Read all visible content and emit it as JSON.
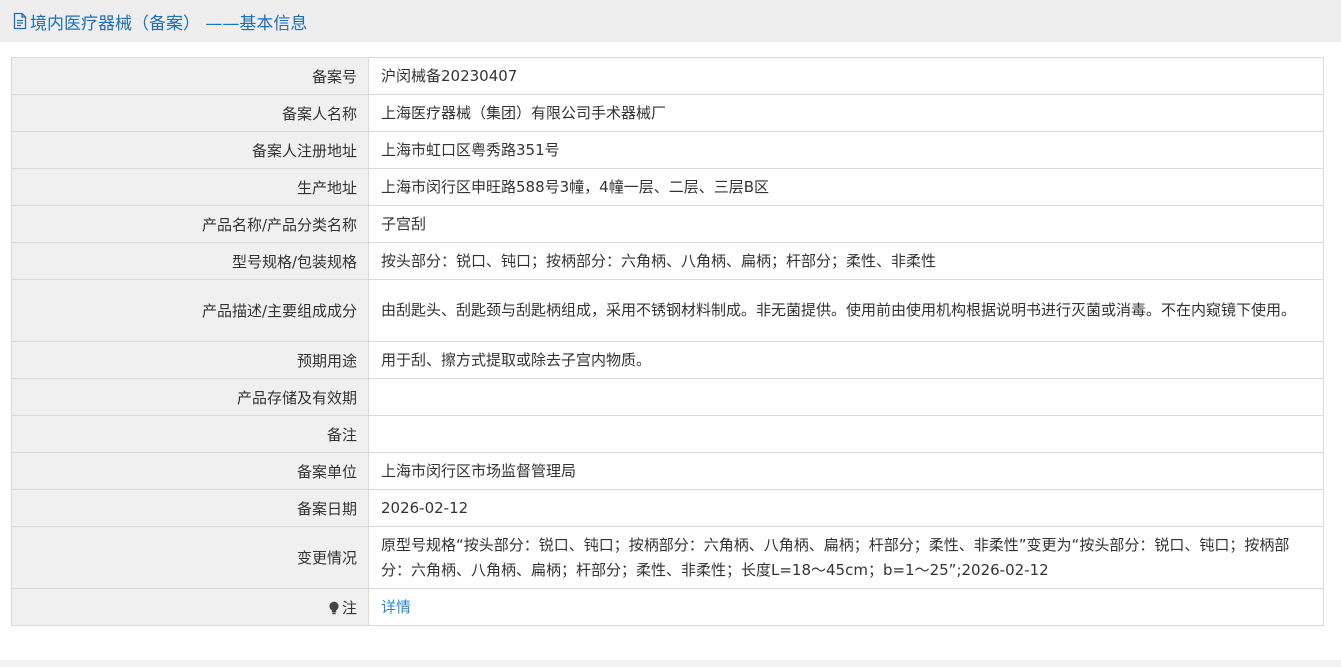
{
  "header": {
    "icon": "document-icon",
    "title": "境内医疗器械（备案） ——基本信息"
  },
  "rows": [
    {
      "label": "备案号",
      "value": "沪闵械备20230407"
    },
    {
      "label": "备案人名称",
      "value": "上海医疗器械（集团）有限公司手术器械厂"
    },
    {
      "label": "备案人注册地址",
      "value": "上海市虹口区粤秀路351号"
    },
    {
      "label": "生产地址",
      "value": "上海市闵行区申旺路588号3幢，4幢一层、二层、三层B区"
    },
    {
      "label": "产品名称/产品分类名称",
      "value": "子宫刮"
    },
    {
      "label": "型号规格/包装规格",
      "value": "按头部分：锐口、钝口；按柄部分：六角柄、八角柄、扁柄；杆部分；柔性、非柔性"
    },
    {
      "label": "产品描述/主要组成成分",
      "value": "由刮匙头、刮匙颈与刮匙柄组成，采用不锈钢材料制成。非无菌提供。使用前由使用机构根据说明书进行灭菌或消毒。不在内窥镜下使用。"
    },
    {
      "label": "预期用途",
      "value": "用于刮、擦方式提取或除去子宫内物质。"
    },
    {
      "label": "产品存储及有效期",
      "value": ""
    },
    {
      "label": "备注",
      "value": ""
    },
    {
      "label": "备案单位",
      "value": "上海市闵行区市场监督管理局"
    },
    {
      "label": "备案日期",
      "value": "2026-02-12"
    },
    {
      "label": "变更情况",
      "value": "原型号规格“按头部分：锐口、钝口；按柄部分：六角柄、八角柄、扁柄；杆部分；柔性、非柔性”变更为“按头部分：锐口、钝口；按柄部分：六角柄、八角柄、扁柄；杆部分；柔性、非柔性；长度L=18～45cm；b=1～25”;2026-02-12"
    }
  ],
  "note": {
    "icon": "lightbulb-icon",
    "label": "注",
    "link_text": "详情"
  },
  "colors": {
    "title": "#1e6fb5",
    "link": "#2a8ad4",
    "label_bg": "#f0f0f0",
    "border": "#d9d9d9"
  }
}
